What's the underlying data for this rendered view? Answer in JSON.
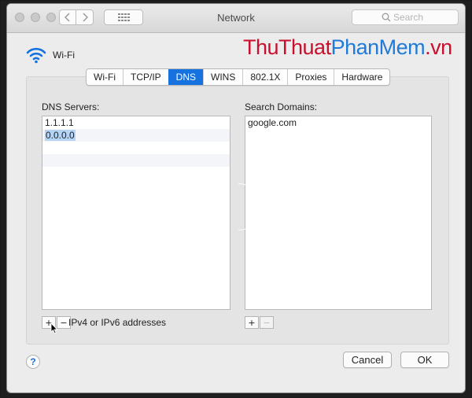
{
  "window": {
    "title": "Network"
  },
  "toolbar": {
    "back_icon": "chevron-left-icon",
    "forward_icon": "chevron-right-icon",
    "grid_icon": "grid-icon",
    "search": {
      "placeholder": "Search",
      "icon": "search-icon"
    }
  },
  "interface": {
    "name": "Wi-Fi",
    "icon": "wifi-icon"
  },
  "watermark": {
    "part1": "ThuThuat",
    "part2": "PhanMem",
    "part3": ".vn"
  },
  "tabs": [
    {
      "label": "Wi-Fi",
      "active": false
    },
    {
      "label": "TCP/IP",
      "active": false
    },
    {
      "label": "DNS",
      "active": true
    },
    {
      "label": "WINS",
      "active": false
    },
    {
      "label": "802.1X",
      "active": false
    },
    {
      "label": "Proxies",
      "active": false
    },
    {
      "label": "Hardware",
      "active": false
    }
  ],
  "dns": {
    "label": "DNS Servers:",
    "servers": [
      "1.1.1.1",
      "0.0.0.0"
    ],
    "selected_index": 1,
    "add_label": "+",
    "remove_label": "−",
    "hint": "IPv4 or IPv6 addresses"
  },
  "search_domains": {
    "label": "Search Domains:",
    "domains": [
      "google.com"
    ],
    "add_label": "+",
    "remove_label": "−"
  },
  "footer": {
    "help_label": "?",
    "cancel_label": "Cancel",
    "ok_label": "OK"
  },
  "colors": {
    "accent": "#1672df",
    "selection": "#b5d3f5",
    "watermark_red": "#c8102e",
    "watermark_blue": "#1f7ad8"
  }
}
